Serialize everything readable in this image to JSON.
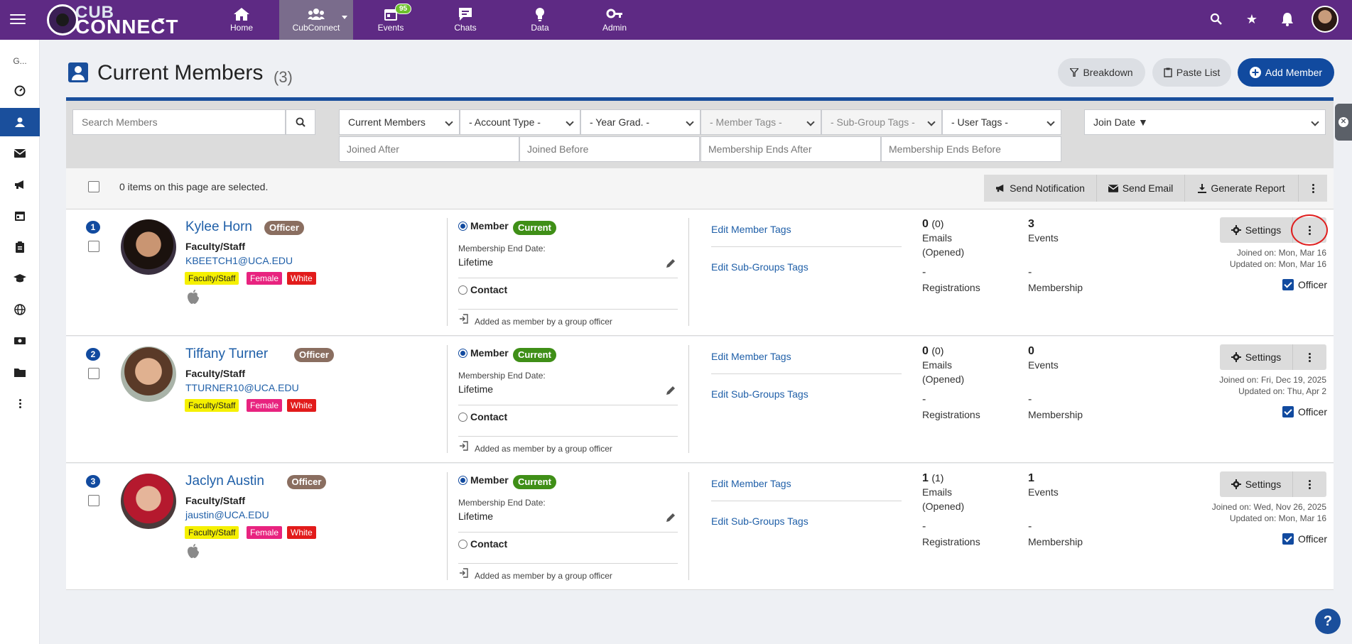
{
  "nav": {
    "logo_line1": "CUB",
    "logo_line2": "CONNECT",
    "items": [
      {
        "label": "Home"
      },
      {
        "label": "CubConnect"
      },
      {
        "label": "Events",
        "badge": "95"
      },
      {
        "label": "Chats"
      },
      {
        "label": "Data"
      },
      {
        "label": "Admin"
      }
    ],
    "right_icons": [
      "search-icon",
      "star-icon",
      "bell-icon"
    ],
    "colors": {
      "bar": "#5e2a84",
      "active": "#7a6c8c",
      "badge": "#6dbf2c"
    }
  },
  "sidebar": {
    "top_label": "G...",
    "icons": [
      "dashboard-icon",
      "members-icon",
      "mail-icon",
      "megaphone-icon",
      "calendar-icon",
      "clipboard-icon",
      "graduation-cap-icon",
      "globe-icon",
      "money-icon",
      "folder-icon",
      "more-vertical-icon"
    ]
  },
  "header": {
    "title": "Current Members",
    "count": "(3)",
    "buttons": {
      "breakdown": "Breakdown",
      "paste_list": "Paste List",
      "add_member": "Add Member"
    }
  },
  "filters": {
    "search_placeholder": "Search Members",
    "selects": {
      "status": "Current Members",
      "account_type": "- Account Type -",
      "year_grad": "- Year Grad. -",
      "member_tags": "- Member Tags -",
      "sub_group_tags": "- Sub-Group Tags -",
      "user_tags": "- User Tags -",
      "sort": "Join Date ▼"
    },
    "dates": {
      "joined_after": "Joined After",
      "joined_before": "Joined Before",
      "ends_after": "Membership Ends After",
      "ends_before": "Membership Ends Before"
    }
  },
  "actions": {
    "selected_text": "0 items on this page are selected.",
    "send_notification": "Send Notification",
    "send_email": "Send Email",
    "generate_report": "Generate Report"
  },
  "members": [
    {
      "index": "1",
      "name": "Kylee Horn",
      "officer_badge": "Officer",
      "role": "Faculty/Staff",
      "email": "KBEETCH1@UCA.EDU",
      "tags": [
        "Faculty/Staff",
        "Female",
        "White"
      ],
      "apple": true,
      "member_label": "Member",
      "status": "Current",
      "end_date_label": "Membership End Date:",
      "end_date": "Lifetime",
      "contact_label": "Contact",
      "added_text": "Added as member by a group officer",
      "edit_member_tags": "Edit Member Tags",
      "edit_subgroup_tags": "Edit Sub-Groups Tags",
      "emails_num": "0",
      "emails_opened": "(0)",
      "emails_label": "Emails",
      "opened_label": "(Opened)",
      "events_num": "3",
      "events_label": "Events",
      "registrations_val": "-",
      "registrations_label": "Registrations",
      "membership_val": "-",
      "membership_label": "Membership",
      "settings": "Settings",
      "joined_on": "Joined on: Mon, Mar 16",
      "updated_on": "Updated on: Mon, Mar 16",
      "officer_label": "Officer"
    },
    {
      "index": "2",
      "name": "Tiffany Turner",
      "officer_badge": "Officer",
      "role": "Faculty/Staff",
      "email": "TTURNER10@UCA.EDU",
      "tags": [
        "Faculty/Staff",
        "Female",
        "White"
      ],
      "apple": false,
      "member_label": "Member",
      "status": "Current",
      "end_date_label": "Membership End Date:",
      "end_date": "Lifetime",
      "contact_label": "Contact",
      "added_text": "Added as member by a group officer",
      "edit_member_tags": "Edit Member Tags",
      "edit_subgroup_tags": "Edit Sub-Groups Tags",
      "emails_num": "0",
      "emails_opened": "(0)",
      "emails_label": "Emails",
      "opened_label": "(Opened)",
      "events_num": "0",
      "events_label": "Events",
      "registrations_val": "-",
      "registrations_label": "Registrations",
      "membership_val": "-",
      "membership_label": "Membership",
      "settings": "Settings",
      "joined_on": "Joined on: Fri, Dec 19, 2025",
      "updated_on": "Updated on: Thu, Apr 2",
      "officer_label": "Officer"
    },
    {
      "index": "3",
      "name": "Jaclyn Austin",
      "officer_badge": "Officer",
      "role": "Faculty/Staff",
      "email": "jaustin@UCA.EDU",
      "tags": [
        "Faculty/Staff",
        "Female",
        "White"
      ],
      "apple": true,
      "member_label": "Member",
      "status": "Current",
      "end_date_label": "Membership End Date:",
      "end_date": "Lifetime",
      "contact_label": "Contact",
      "added_text": "Added as member by a group officer",
      "edit_member_tags": "Edit Member Tags",
      "edit_subgroup_tags": "Edit Sub-Groups Tags",
      "emails_num": "1",
      "emails_opened": "(1)",
      "emails_label": "Emails",
      "opened_label": "(Opened)",
      "events_num": "1",
      "events_label": "Events",
      "registrations_val": "-",
      "registrations_label": "Registrations",
      "membership_val": "-",
      "membership_label": "Membership",
      "settings": "Settings",
      "joined_on": "Joined on: Wed, Nov 26, 2025",
      "updated_on": "Updated on: Mon, Mar 16",
      "officer_label": "Officer"
    }
  ],
  "help": "?"
}
